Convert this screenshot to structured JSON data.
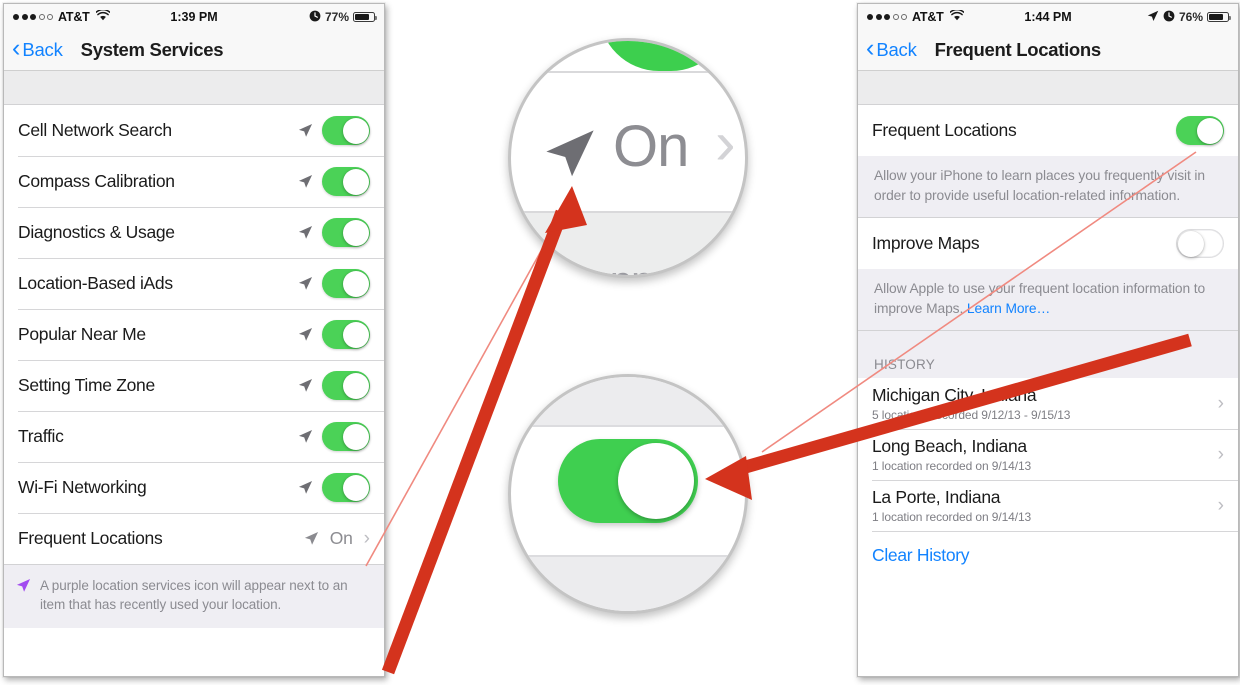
{
  "left_phone": {
    "status_bar": {
      "signal_dots_filled": 3,
      "signal_dots_empty": 2,
      "carrier": "AT&T",
      "wifi_icon": "wifi-icon",
      "time": "1:39 PM",
      "alarm_icon": "alarm-clock-icon",
      "battery_percent": "77%",
      "battery_icon": "battery-icon"
    },
    "nav": {
      "back_label": "Back",
      "back_icon": "chevron-left-icon",
      "title": "System Services"
    },
    "rows": [
      {
        "label": "Cell Network Search",
        "icon": "location-arrow-icon",
        "control": "toggle",
        "state": "on"
      },
      {
        "label": "Compass Calibration",
        "icon": "location-arrow-icon",
        "control": "toggle",
        "state": "on"
      },
      {
        "label": "Diagnostics & Usage",
        "icon": "location-arrow-icon",
        "control": "toggle",
        "state": "on"
      },
      {
        "label": "Location-Based iAds",
        "icon": "location-arrow-icon",
        "control": "toggle",
        "state": "on"
      },
      {
        "label": "Popular Near Me",
        "icon": "location-arrow-icon",
        "control": "toggle",
        "state": "on"
      },
      {
        "label": "Setting Time Zone",
        "icon": "location-arrow-icon",
        "control": "toggle",
        "state": "on"
      },
      {
        "label": "Traffic",
        "icon": "location-arrow-icon",
        "control": "toggle",
        "state": "on"
      },
      {
        "label": "Wi-Fi Networking",
        "icon": "location-arrow-icon",
        "control": "toggle",
        "state": "on"
      },
      {
        "label": "Frequent Locations",
        "icon": "location-arrow-icon",
        "control": "disclosure",
        "value": "On"
      }
    ],
    "footer": {
      "icon": "purple-location-arrow-icon",
      "text": "A purple location services icon will appear next to an item that has recently used your location."
    }
  },
  "right_phone": {
    "status_bar": {
      "signal_dots_filled": 3,
      "signal_dots_empty": 2,
      "carrier": "AT&T",
      "wifi_icon": "wifi-icon",
      "time": "1:44 PM",
      "location_icon": "location-arrow-icon",
      "alarm_icon": "alarm-clock-icon",
      "battery_percent": "76%",
      "battery_icon": "battery-icon"
    },
    "nav": {
      "back_label": "Back",
      "back_icon": "chevron-left-icon",
      "title": "Frequent Locations"
    },
    "frequent_locations_row": {
      "label": "Frequent Locations",
      "control": "toggle",
      "state": "on"
    },
    "frequent_locations_desc": "Allow your iPhone to learn places you frequently visit in order to provide useful location-related information.",
    "improve_maps_row": {
      "label": "Improve Maps",
      "control": "toggle",
      "state": "off"
    },
    "improve_maps_desc_prefix": "Allow Apple to use your frequent location information to improve Maps. ",
    "improve_maps_desc_link": "Learn More…",
    "history_header": "HISTORY",
    "history": [
      {
        "title": "Michigan City, Indiana",
        "subtitle": "5 locations recorded 9/12/13 - 9/15/13"
      },
      {
        "title": "Long Beach, Indiana",
        "subtitle": "1 location recorded on 9/14/13"
      },
      {
        "title": "La Porte, Indiana",
        "subtitle": "1 location recorded on 9/14/13"
      }
    ],
    "clear_history_label": "Clear History"
  },
  "magnifiers": {
    "top": {
      "value_text": "On",
      "chevron_icon": "chevron-right-icon",
      "location_icon": "location-arrow-icon",
      "clipped_text": "ill app"
    },
    "bottom": {
      "toggle_state": "on",
      "toggle_color": "#3fcf50"
    }
  },
  "annotations": {
    "arrow_color": "#d4331d",
    "callout_line_color": "#f08a80",
    "arrow_top_target": "location-arrow-in-frequent-locations-row",
    "arrow_bottom_target": "frequent-locations-toggle"
  },
  "colors": {
    "toggle_on": "#4bd257",
    "link_blue": "#1283ff",
    "gray_bg": "#efeef3",
    "separator": "#d6d6d8",
    "text_primary": "#1b1b1b",
    "text_secondary": "#8b8b91",
    "purple_arrow": "#a24bf0"
  }
}
